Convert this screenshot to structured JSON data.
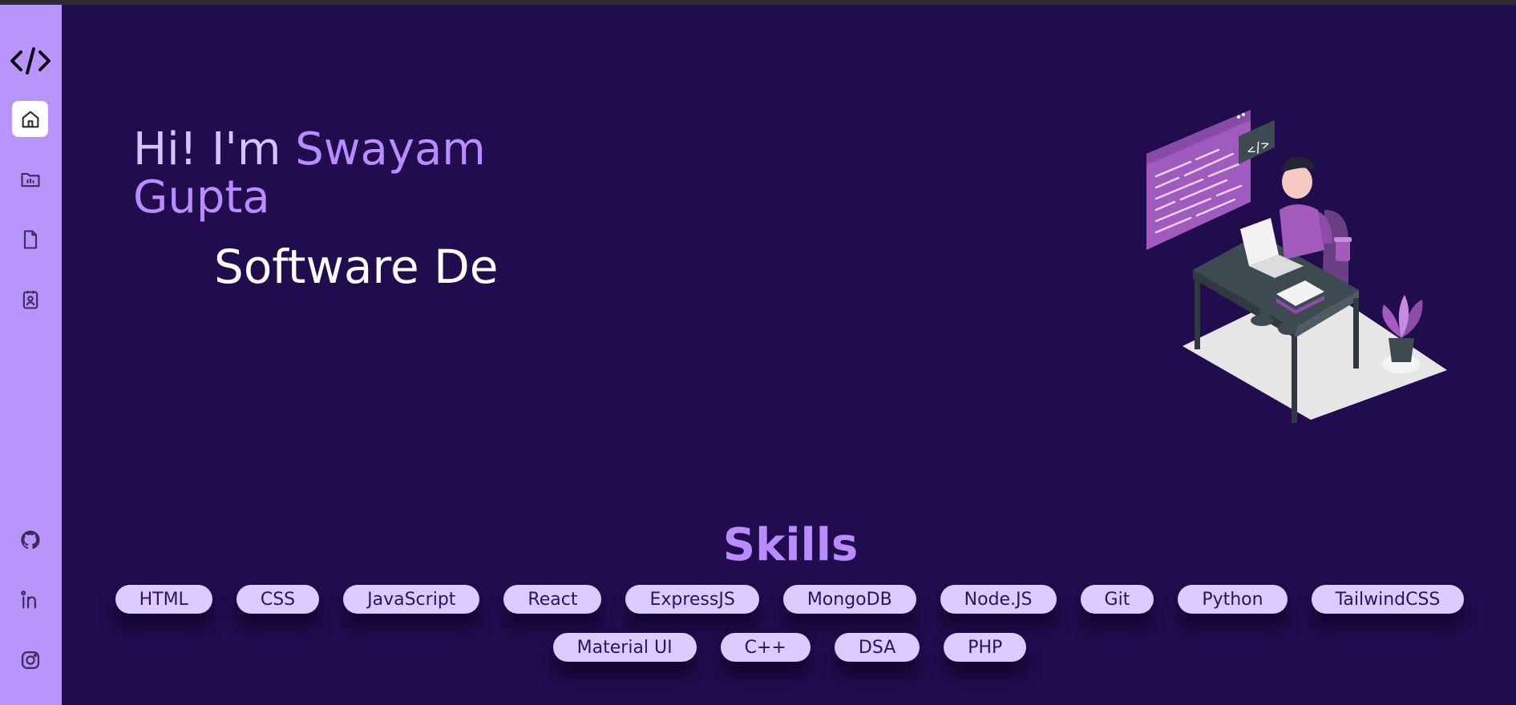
{
  "hero": {
    "greeting": "Hi! I'm ",
    "first_name": "Swayam",
    "last_name": "Gupta",
    "role": "Software De"
  },
  "sidebar": {
    "logo": "code-icon",
    "items": [
      {
        "icon": "home-icon",
        "active": true
      },
      {
        "icon": "projects-icon",
        "active": false
      },
      {
        "icon": "resume-icon",
        "active": false
      },
      {
        "icon": "contact-icon",
        "active": false
      }
    ],
    "socials": [
      {
        "icon": "github-icon"
      },
      {
        "icon": "linkedin-icon"
      },
      {
        "icon": "instagram-icon"
      }
    ]
  },
  "skills": {
    "title": "Skills",
    "items": [
      "HTML",
      "CSS",
      "JavaScript",
      "React",
      "ExpressJS",
      "MongoDB",
      "Node.JS",
      "Git",
      "Python",
      "TailwindCSS",
      "Material UI",
      "C++",
      "DSA",
      "PHP"
    ]
  },
  "colors": {
    "background": "#210c4e",
    "sidebar": "#b895fb",
    "accent": "#b98cff",
    "chip": "#dccbff"
  }
}
